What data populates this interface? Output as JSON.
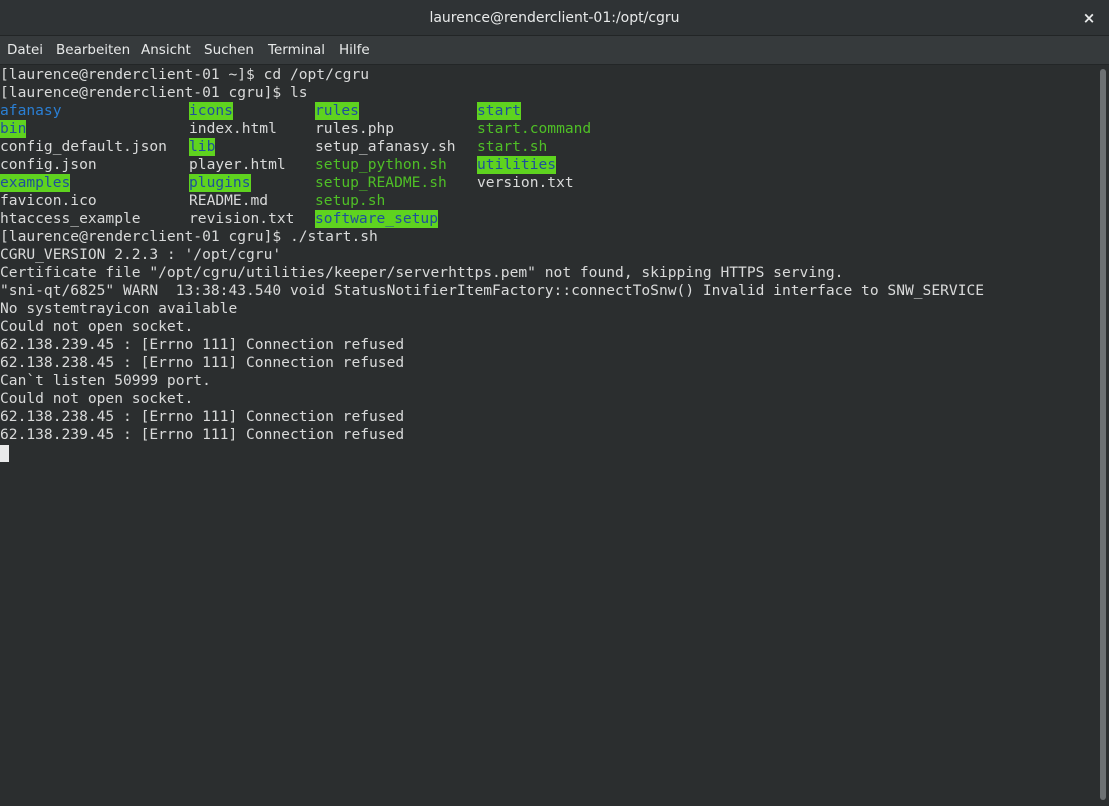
{
  "window": {
    "title": "laurence@renderclient-01:/opt/cgru",
    "close_icon": "×"
  },
  "menu": [
    "Datei",
    "Bearbeiten",
    "Ansicht",
    "Suchen",
    "Terminal",
    "Hilfe"
  ],
  "colors": {
    "background": "#2b2e2f",
    "text": "#d9dada",
    "directory": "#2a7fd4",
    "executable": "#4fbf26",
    "highlight_bg": "#5fd31f",
    "highlight_fg": "#1f4f9b"
  },
  "terminal": {
    "prompt1": "[laurence@renderclient-01 ~]$ cd /opt/cgru",
    "prompt2": "[laurence@renderclient-01 cgru]$ ls",
    "ls": [
      {
        "name": "afanasy",
        "style": "dir"
      },
      {
        "name": "bin",
        "style": "hl"
      },
      {
        "name": "config_default.json",
        "style": "plain"
      },
      {
        "name": "config.json",
        "style": "plain"
      },
      {
        "name": "examples",
        "style": "hl"
      },
      {
        "name": "favicon.ico",
        "style": "plain"
      },
      {
        "name": "htaccess_example",
        "style": "plain"
      },
      {
        "name": "icons",
        "style": "hl"
      },
      {
        "name": "index.html",
        "style": "plain"
      },
      {
        "name": "lib",
        "style": "hl"
      },
      {
        "name": "player.html",
        "style": "plain"
      },
      {
        "name": "plugins",
        "style": "hl"
      },
      {
        "name": "README.md",
        "style": "plain"
      },
      {
        "name": "revision.txt",
        "style": "plain"
      },
      {
        "name": "rules",
        "style": "hl"
      },
      {
        "name": "rules.php",
        "style": "plain"
      },
      {
        "name": "setup_afanasy.sh",
        "style": "plain"
      },
      {
        "name": "setup_python.sh",
        "style": "exec"
      },
      {
        "name": "setup_README.sh",
        "style": "exec"
      },
      {
        "name": "setup.sh",
        "style": "exec"
      },
      {
        "name": "software_setup",
        "style": "hl"
      },
      {
        "name": "start",
        "style": "hl"
      },
      {
        "name": "start.command",
        "style": "exec"
      },
      {
        "name": "start.sh",
        "style": "exec"
      },
      {
        "name": "utilities",
        "style": "hl"
      },
      {
        "name": "version.txt",
        "style": "plain"
      }
    ],
    "output": [
      "[laurence@renderclient-01 cgru]$ ./start.sh",
      "CGRU_VERSION 2.2.3 : '/opt/cgru'",
      "Certificate file \"/opt/cgru/utilities/keeper/serverhttps.pem\" not found, skipping HTTPS serving.",
      "\"sni-qt/6825\" WARN  13:38:43.540 void StatusNotifierItemFactory::connectToSnw() Invalid interface to SNW_SERVICE",
      "No systemtrayicon available",
      "Could not open socket.",
      "62.138.239.45 : [Errno 111] Connection refused",
      "62.138.238.45 : [Errno 111] Connection refused",
      "Can`t listen 50999 port.",
      "Could not open socket.",
      "62.138.238.45 : [Errno 111] Connection refused",
      "62.138.239.45 : [Errno 111] Connection refused"
    ]
  }
}
